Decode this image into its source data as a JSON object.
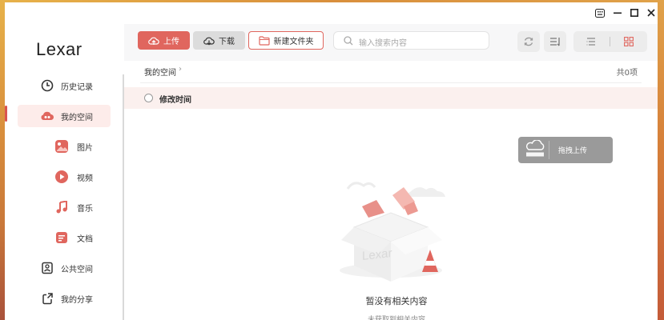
{
  "window": {
    "controls": {
      "ime": "⌨",
      "minimize": "—",
      "maximize": "□",
      "close": "✕"
    }
  },
  "brand": {
    "logo_text": "Lexar"
  },
  "sidebar": {
    "items": [
      {
        "label": "历史记录",
        "icon": "clock-icon"
      },
      {
        "label": "我的空间",
        "icon": "cloud-icon",
        "active": true
      },
      {
        "label": "图片",
        "icon": "image-icon"
      },
      {
        "label": "视频",
        "icon": "video-icon"
      },
      {
        "label": "音乐",
        "icon": "music-icon"
      },
      {
        "label": "文档",
        "icon": "document-icon"
      },
      {
        "label": "公共空间",
        "icon": "public-space-icon"
      },
      {
        "label": "我的分享",
        "icon": "share-icon"
      }
    ]
  },
  "toolbar": {
    "upload_label": "上传",
    "download_label": "下载",
    "new_folder_label": "新建文件夹",
    "search_placeholder": "输入搜索内容"
  },
  "breadcrumb": {
    "current": "我的空间",
    "count_text": "共0项"
  },
  "table": {
    "header": "修改时间"
  },
  "drag_upload": {
    "label": "拖拽上传"
  },
  "empty_state": {
    "title": "暂没有相关内容",
    "subtitle": "未获取到相关内容",
    "illustration_brand": "Lexar"
  },
  "colors": {
    "accent": "#e0665e",
    "active_bg": "#fdecea",
    "header_bg": "#fbf0ee"
  }
}
